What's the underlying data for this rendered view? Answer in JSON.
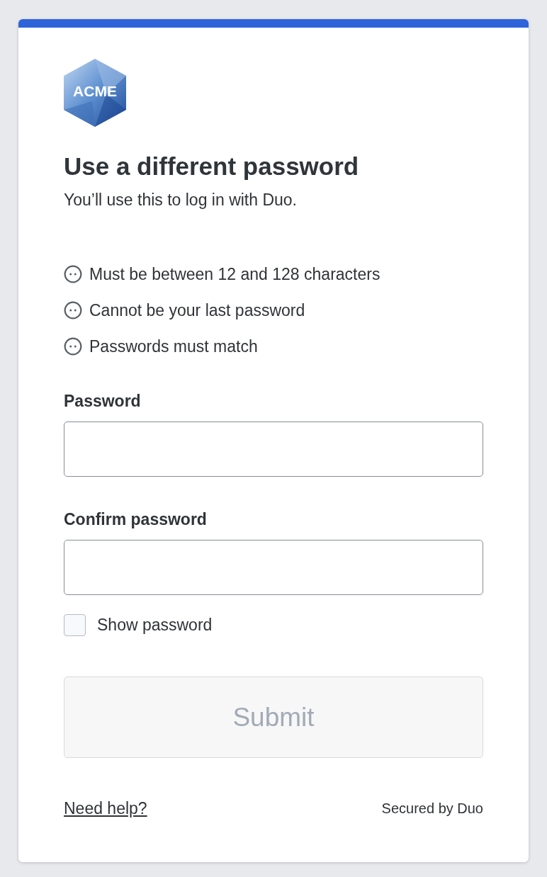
{
  "logo": {
    "text": "ACME"
  },
  "title": "Use a different password",
  "subtitle": "You’ll use this to log in with Duo.",
  "requirements": [
    {
      "text": "Must be between 12 and 128 characters",
      "met": false
    },
    {
      "text": "Cannot be your last password",
      "met": false
    },
    {
      "text": "Passwords must match",
      "met": false
    }
  ],
  "fields": [
    {
      "label": "Password"
    },
    {
      "label": "Confirm password"
    }
  ],
  "show_password": {
    "label": "Show password",
    "checked": false
  },
  "submit": {
    "label": "Submit",
    "disabled": true
  },
  "footer": {
    "help_link": "Need help?",
    "secured_by": "Secured by Duo"
  }
}
